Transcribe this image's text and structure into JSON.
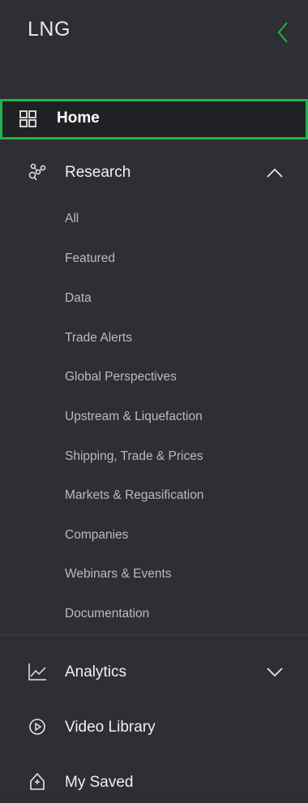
{
  "app": {
    "title": "LNG"
  },
  "nav": {
    "home": "Home",
    "research": "Research",
    "research_items": [
      "All",
      "Featured",
      "Data",
      "Trade Alerts",
      "Global Perspectives",
      "Upstream & Liquefaction",
      "Shipping, Trade & Prices",
      "Markets & Regasification",
      "Companies",
      "Webinars & Events",
      "Documentation"
    ],
    "analytics": "Analytics",
    "video_library": "Video Library",
    "my_saved": "My Saved"
  },
  "colors": {
    "accent": "#1fb14b",
    "background": "#2d2f33",
    "active_bg": "#1f2124"
  }
}
